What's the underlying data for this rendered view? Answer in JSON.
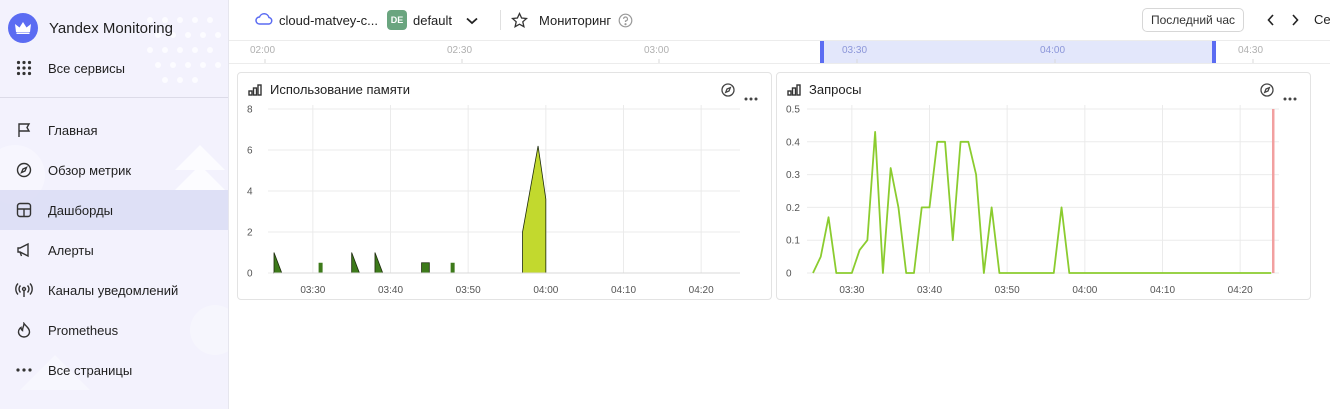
{
  "sidebar": {
    "brand": "Yandex Monitoring",
    "all_services": "Все сервисы",
    "items": [
      {
        "label": "Главная",
        "icon": "flag-icon"
      },
      {
        "label": "Обзор метрик",
        "icon": "compass-icon"
      },
      {
        "label": "Дашборды",
        "icon": "dashboard-icon"
      },
      {
        "label": "Алерты",
        "icon": "megaphone-icon"
      },
      {
        "label": "Каналы уведомлений",
        "icon": "broadcast-icon"
      },
      {
        "label": "Prometheus",
        "icon": "flame-icon"
      },
      {
        "label": "Все страницы",
        "icon": "dots-icon"
      }
    ]
  },
  "topbar": {
    "cloud": "cloud-matvey-c...",
    "folder_badge": "DE",
    "folder": "default",
    "service": "Мониторинг",
    "range_button": "Последний час",
    "truncated_right": "Се"
  },
  "timeline": {
    "labels": [
      "02:00",
      "02:30",
      "03:00",
      "03:30",
      "04:00",
      "04:30"
    ]
  },
  "panels": [
    {
      "title": "Использование памяти"
    },
    {
      "title": "Запросы"
    }
  ],
  "chart_data": [
    {
      "type": "area",
      "title": "Использование памяти",
      "x_tick_labels": [
        "03:30",
        "03:40",
        "03:50",
        "04:00",
        "04:10",
        "04:20"
      ],
      "y_tick_labels": [
        "0",
        "2",
        "4",
        "6",
        "8"
      ],
      "xlim": [
        "03:25",
        "04:25"
      ],
      "ylim": [
        0,
        8
      ],
      "grid": true,
      "colors": [
        "#3d7a1a",
        "#c2d92e"
      ],
      "series": [
        {
          "segments": [
            {
              "x": [
                "03:25",
                "03:26"
              ],
              "y": [
                1.0,
                0
              ]
            },
            {
              "x": [
                "03:31"
              ],
              "y": [
                0.5
              ]
            },
            {
              "x": [
                "03:35",
                "03:36"
              ],
              "y": [
                1.0,
                0
              ]
            },
            {
              "x": [
                "03:38",
                "03:39"
              ],
              "y": [
                1.0,
                0
              ]
            },
            {
              "x": [
                "03:44",
                "03:45"
              ],
              "y": [
                0.5,
                0.5
              ]
            },
            {
              "x": [
                "03:48"
              ],
              "y": [
                0.5
              ]
            },
            {
              "x": [
                "03:57",
                "03:59",
                "04:00"
              ],
              "y": [
                2.0,
                6.2,
                3.6
              ],
              "color": "#c2d92e"
            }
          ]
        }
      ]
    },
    {
      "type": "line",
      "title": "Запросы",
      "x_tick_labels": [
        "03:30",
        "03:40",
        "03:50",
        "04:00",
        "04:10",
        "04:20"
      ],
      "y_tick_labels": [
        "0",
        "0.1",
        "0.2",
        "0.3",
        "0.4",
        "0.5"
      ],
      "xlim": [
        "03:25",
        "04:25"
      ],
      "ylim": [
        0,
        0.5
      ],
      "grid": true,
      "colors": [
        "#8bcc2f"
      ],
      "series": [
        {
          "x": [
            "03:25",
            "03:26",
            "03:27",
            "03:28",
            "03:29",
            "03:30",
            "03:31",
            "03:32",
            "03:33",
            "03:34",
            "03:35",
            "03:36",
            "03:37",
            "03:38",
            "03:39",
            "03:40",
            "03:41",
            "03:42",
            "03:43",
            "03:44",
            "03:45",
            "03:46",
            "03:47",
            "03:48",
            "03:49",
            "03:50",
            "03:51",
            "03:52",
            "03:53",
            "03:54",
            "03:55",
            "03:56",
            "03:57",
            "03:58",
            "04:00",
            "04:24"
          ],
          "y": [
            0,
            0.05,
            0.17,
            0,
            0,
            0,
            0.07,
            0.1,
            0.43,
            0,
            0.32,
            0.2,
            0,
            0,
            0.2,
            0.2,
            0.4,
            0.4,
            0.1,
            0.4,
            0.4,
            0.3,
            0,
            0.2,
            0,
            0,
            0,
            0,
            0,
            0,
            0,
            0,
            0.2,
            0,
            0,
            0
          ]
        }
      ],
      "marker_color": "#f2a0a0"
    }
  ]
}
